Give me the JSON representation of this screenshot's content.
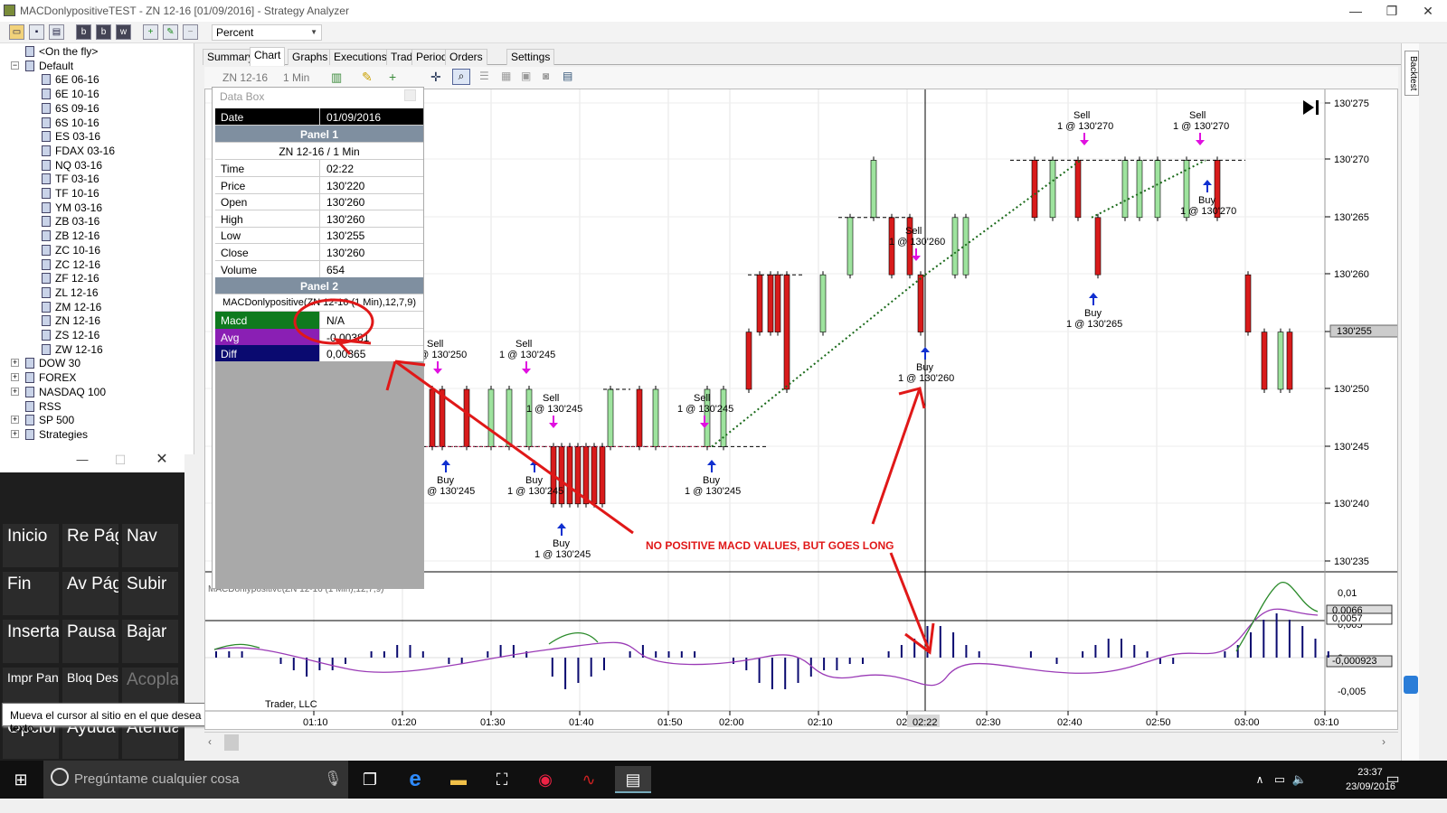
{
  "window": {
    "title": "MACDonlypositiveTEST - ZN 12-16 [01/09/2016] - Strategy Analyzer",
    "min": "—",
    "max": "❐",
    "close": "✕"
  },
  "toolbar": {
    "display_unit": "Percent",
    "buttons": [
      "b",
      "b",
      "w"
    ]
  },
  "tree": {
    "items": [
      {
        "label": "<On the fly>",
        "depth": 1
      },
      {
        "label": "Default",
        "depth": 1,
        "expand": "−"
      },
      {
        "label": "6E 06-16",
        "depth": 2
      },
      {
        "label": "6E 10-16",
        "depth": 2
      },
      {
        "label": "6S 09-16",
        "depth": 2
      },
      {
        "label": "6S 10-16",
        "depth": 2
      },
      {
        "label": "ES 03-16",
        "depth": 2
      },
      {
        "label": "FDAX 03-16",
        "depth": 2
      },
      {
        "label": "NQ 03-16",
        "depth": 2
      },
      {
        "label": "TF 03-16",
        "depth": 2
      },
      {
        "label": "TF 10-16",
        "depth": 2
      },
      {
        "label": "YM 03-16",
        "depth": 2
      },
      {
        "label": "ZB 03-16",
        "depth": 2
      },
      {
        "label": "ZB 12-16",
        "depth": 2
      },
      {
        "label": "ZC 10-16",
        "depth": 2
      },
      {
        "label": "ZC 12-16",
        "depth": 2
      },
      {
        "label": "ZF 12-16",
        "depth": 2
      },
      {
        "label": "ZL 12-16",
        "depth": 2
      },
      {
        "label": "ZM 12-16",
        "depth": 2
      },
      {
        "label": "ZN 12-16",
        "depth": 2
      },
      {
        "label": "ZS 12-16",
        "depth": 2
      },
      {
        "label": "ZW 12-16",
        "depth": 2
      },
      {
        "label": "DOW 30",
        "depth": 1,
        "expand": "+"
      },
      {
        "label": "FOREX",
        "depth": 1,
        "expand": "+"
      },
      {
        "label": "NASDAQ 100",
        "depth": 1,
        "expand": "+"
      },
      {
        "label": "RSS",
        "depth": 1
      },
      {
        "label": "SP 500",
        "depth": 1,
        "expand": "+"
      },
      {
        "label": "Strategies",
        "depth": 1,
        "expand": "+"
      }
    ]
  },
  "osk": {
    "keys": [
      {
        "label": "Inicio",
        "dim": false
      },
      {
        "label": "Re Pág",
        "dim": false
      },
      {
        "label": "Nav",
        "dim": false
      },
      {
        "label": "Fin",
        "dim": false
      },
      {
        "label": "Av Pág",
        "dim": false
      },
      {
        "label": "Subir",
        "dim": false
      },
      {
        "label": "Insertar",
        "dim": false
      },
      {
        "label": "Pausa",
        "dim": false
      },
      {
        "label": "Bajar",
        "dim": false
      },
      {
        "label": "Impr Pant",
        "dim": false
      },
      {
        "label": "Bloq Despl",
        "dim": false
      },
      {
        "label": "Acoplar",
        "dim": true
      },
      {
        "label": "Opciones",
        "dim": false
      },
      {
        "label": "Ayuda",
        "dim": false
      },
      {
        "label": "Atenuar",
        "dim": false
      }
    ],
    "min": "—",
    "max": "☐",
    "close": "✕"
  },
  "tooltip": "Mueva el cursor al sitio en el que desea escribir texto.",
  "tabs": [
    "Summary",
    "Chart",
    "Graphs",
    "Executions",
    "Trades",
    "Periods",
    "Orders",
    "Settings"
  ],
  "active_tab": "Chart",
  "chart_toolbar": {
    "instrument": "ZN 12-16",
    "interval": "1 Min"
  },
  "databox": {
    "title": "Data Box",
    "date_label": "Date",
    "date_value": "01/09/2016",
    "panel1": "Panel 1",
    "panel1_sub": "ZN 12-16 / 1 Min",
    "rows": [
      [
        "Time",
        "02:22"
      ],
      [
        "Price",
        "130'220"
      ],
      [
        "Open",
        "130'260"
      ],
      [
        "High",
        "130'260"
      ],
      [
        "Low",
        "130'255"
      ],
      [
        "Close",
        "130'260"
      ],
      [
        "Volume",
        "654"
      ]
    ],
    "panel2": "Panel 2",
    "panel2_sub": "MACDonlypositive(ZN 12-16 (1 Min),12,7,9)",
    "ind": [
      [
        "Macd",
        "N/A",
        "#0f7a1e"
      ],
      [
        "Avg",
        "-0,00381",
        "#8a1fb4"
      ],
      [
        "Diff",
        "0,00365",
        "#0a0a70"
      ]
    ]
  },
  "right_panel_label": "Backtest",
  "chart_text": {
    "crosshair_time": "02:22",
    "copyright": "Trader, LLC",
    "panel2_label": "MACDonlypositive(ZN 12-16 (1 Min),12,7,9)"
  },
  "annotation": "NO POSITIVE MACD VALUES, BUT GOES LONG",
  "price_axis": [
    "130'275",
    "130'270",
    "130'265",
    "130'260",
    "130'255",
    "130'250",
    "130'245",
    "130'240",
    "130'235"
  ],
  "current_price": "130'255",
  "macd_axis": [
    "0,01",
    "0,005",
    "0",
    "-0,005"
  ],
  "macd_flags": [
    "0,0066",
    "0,0057",
    "-0,000923"
  ],
  "time_axis": [
    "01:10",
    "01:20",
    "01:30",
    "01:40",
    "01:50",
    "02:00",
    "02:10",
    "02:20",
    "02:30",
    "02:40",
    "02:50",
    "03:00",
    "03:10"
  ],
  "chart_data": {
    "type": "candlestick",
    "trades": [
      {
        "side": "Sell",
        "label": "1 @ 130'250"
      },
      {
        "side": "Buy",
        "label": "1 @ 130'245"
      },
      {
        "side": "Sell",
        "label": "1 @ 130'245"
      },
      {
        "side": "Sell",
        "label": "1 @ 130'245"
      },
      {
        "side": "Buy",
        "label": "1 @ 130'245"
      },
      {
        "side": "Buy",
        "label": "1 @ 130'245"
      },
      {
        "side": "Sell",
        "label": "1 @ 130'245"
      },
      {
        "side": "Buy",
        "label": "1 @ 130'245"
      },
      {
        "side": "Sell",
        "label": "1 @ 130'260"
      },
      {
        "side": "Buy",
        "label": "1 @ 130'260"
      },
      {
        "side": "Sell",
        "label": "1 @ 130'270"
      },
      {
        "side": "Buy",
        "label": "1 @ 130'265"
      },
      {
        "side": "Sell",
        "label": "1 @ 130'270"
      },
      {
        "side": "Buy",
        "label": "1 @ 130'270"
      }
    ],
    "ylim": [
      130.234,
      130.277
    ]
  },
  "taskbar": {
    "search": "Pregúntame cualquier cosa",
    "time": "23:37",
    "date": "23/09/2016"
  }
}
